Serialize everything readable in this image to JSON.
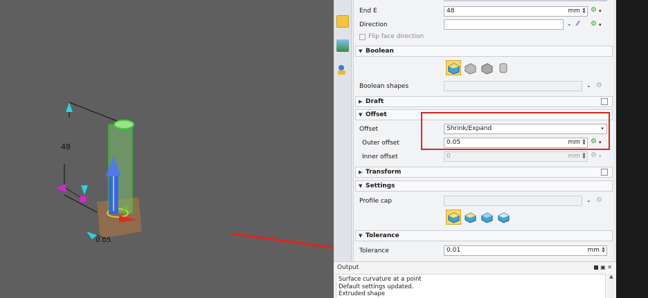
{
  "viewport": {
    "dimension_height": "48",
    "dimension_offset": "0.05"
  },
  "props": {
    "end_e": {
      "label": "End E",
      "value": "48",
      "unit": "mm"
    },
    "direction": {
      "label": "Direction",
      "value": ""
    },
    "flip_face": {
      "label": "Flip face direction"
    },
    "boolean": {
      "title": "Boolean",
      "shapes_label": "Boolean shapes"
    },
    "draft": {
      "title": "Draft"
    },
    "offset": {
      "title": "Offset",
      "offset_label": "Offset",
      "offset_value": "Shrink/Expand",
      "outer_label": "Outer offset",
      "outer_value": "0.05",
      "outer_unit": "mm",
      "inner_label": "Inner offset",
      "inner_value": "0",
      "inner_unit": "mm"
    },
    "transform": {
      "title": "Transform"
    },
    "settings": {
      "title": "Settings",
      "profile_cap_label": "Profile cap"
    },
    "tolerance": {
      "title": "Tolerance",
      "label": "Tolerance",
      "value": "0.01",
      "unit": "mm"
    }
  },
  "output": {
    "title": "Output",
    "lines": [
      "Surface curvature at a point",
      "Default settings updated.",
      "Extruded shape"
    ]
  },
  "colors": {
    "highlight_red": "#e0241c",
    "selected_button": "#f7d66a",
    "viewport_bg": "#5f5f5f"
  }
}
